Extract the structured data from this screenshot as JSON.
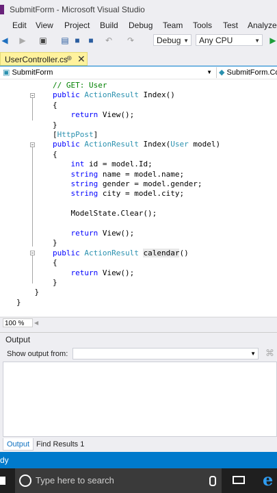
{
  "window": {
    "title": "SubmitForm - Microsoft Visual Studio"
  },
  "menu": [
    "Edit",
    "View",
    "Project",
    "Build",
    "Debug",
    "Team",
    "Tools",
    "Test",
    "Analyze"
  ],
  "toolbar": {
    "config": "Debug",
    "platform": "Any CPU"
  },
  "tab": {
    "name": "UserController.cs",
    "pin": "⊕",
    "close": "✕"
  },
  "navbar": {
    "left": "SubmitForm",
    "right": "SubmitForm.Co"
  },
  "code": [
    {
      "text": "        // GET: User",
      "cls": "cm"
    },
    {
      "text": "        public ActionResult Index()"
    },
    {
      "text": "        {"
    },
    {
      "text": "            return View();"
    },
    {
      "text": "        }"
    },
    {
      "text": "        [HttpPost]"
    },
    {
      "text": "        public ActionResult Index(User model)"
    },
    {
      "text": "        {"
    },
    {
      "text": "            int id = model.Id;"
    },
    {
      "text": "            string name = model.name;"
    },
    {
      "text": "            string gender = model.gender;"
    },
    {
      "text": "            string city = model.city;"
    },
    {
      "text": ""
    },
    {
      "text": "            ModelState.Clear();"
    },
    {
      "text": ""
    },
    {
      "text": "            return View();"
    },
    {
      "text": "        }"
    },
    {
      "text": "        public ActionResult calendar()"
    },
    {
      "text": "        {"
    },
    {
      "text": "            return View();"
    },
    {
      "text": "        }"
    },
    {
      "text": "    }"
    },
    {
      "text": "}"
    }
  ],
  "zoom": "100 %",
  "output": {
    "title": "Output",
    "show_from_label": "Show output from:",
    "show_from_value": ""
  },
  "bottom_tabs": [
    "Output",
    "Find Results 1"
  ],
  "status": {
    "text": "dy"
  },
  "taskbar": {
    "search_placeholder": "Type here to search"
  }
}
